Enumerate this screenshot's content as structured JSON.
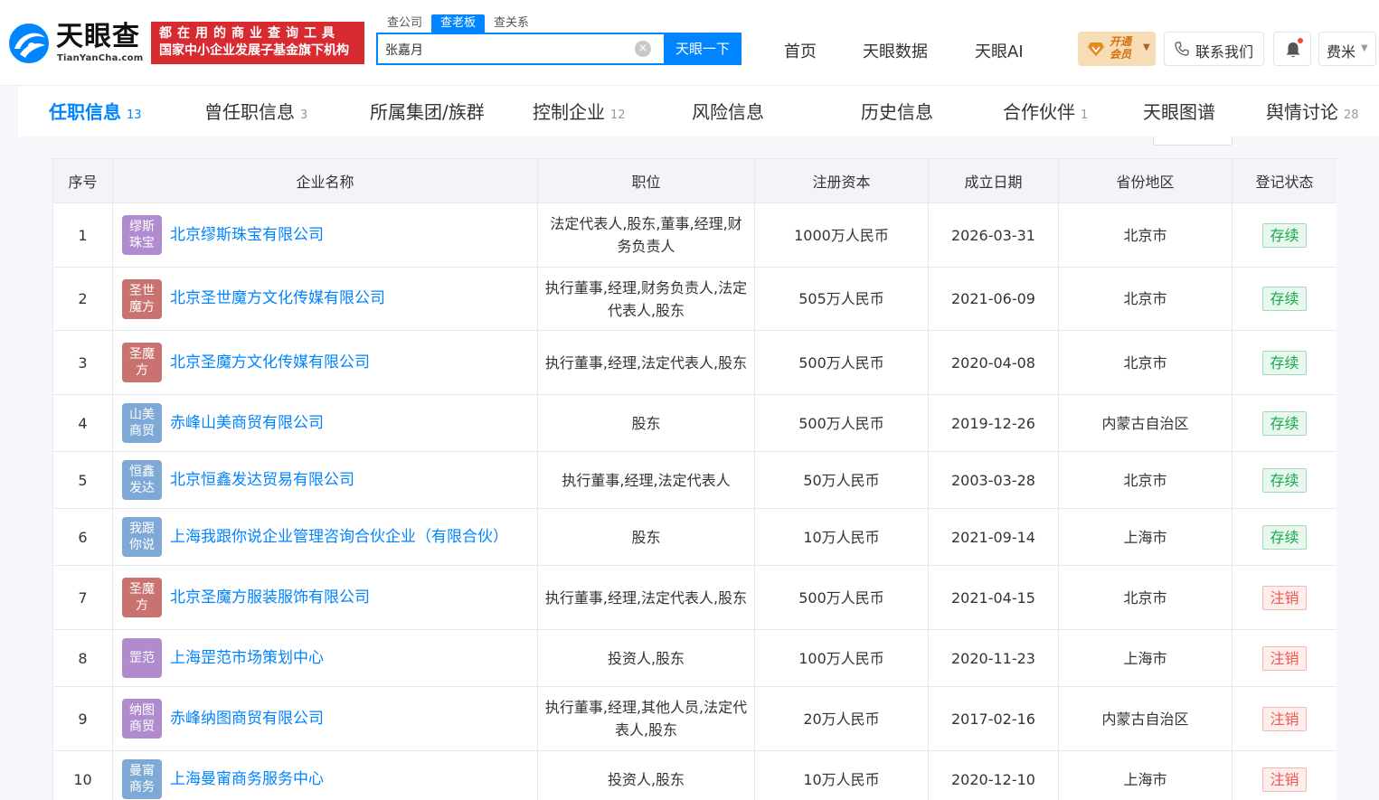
{
  "brand": {
    "title": "天眼查",
    "subtitle": "TianYanCha.com",
    "slogan_line1": "都在用的商业查询工具",
    "slogan_line2": "国家中小企业发展子基金旗下机构",
    "color_brand": "#0084ff",
    "color_slogan": "#d72a31"
  },
  "search": {
    "tabs": [
      "查公司",
      "查老板",
      "查关系"
    ],
    "active_tab": "查老板",
    "value": "张嘉月",
    "button": "天眼一下"
  },
  "nav": {
    "items": [
      "首页",
      "天眼数据",
      "天眼AI"
    ],
    "vip_line1": "开通",
    "vip_line2": "会员",
    "contact": "联系我们",
    "user": "费米"
  },
  "tabs": [
    {
      "label": "任职信息",
      "count": "13",
      "active": true
    },
    {
      "label": "曾任职信息",
      "count": "3"
    },
    {
      "label": "所属集团/族群",
      "count": ""
    },
    {
      "label": "控制企业",
      "count": "12"
    },
    {
      "label": "风险信息",
      "count": ""
    },
    {
      "label": "历史信息",
      "count": ""
    },
    {
      "label": "合作伙伴",
      "count": "1"
    },
    {
      "label": "天眼图谱",
      "count": ""
    },
    {
      "label": "舆情讨论",
      "count": "28"
    }
  ],
  "table": {
    "headers": [
      "序号",
      "企业名称",
      "职位",
      "注册资本",
      "成立日期",
      "省份地区",
      "登记状态"
    ],
    "rows": [
      {
        "no": "1",
        "logo": "缪斯\n珠宝",
        "logo_color": "#b08ccf",
        "name": "北京缪斯珠宝有限公司",
        "role": "法定代表人,股东,董事,经理,财务负责人",
        "capital": "1000万人民币",
        "date": "2026-03-31",
        "region": "北京市",
        "status": "存续",
        "status_type": "green"
      },
      {
        "no": "2",
        "logo": "圣世\n魔方",
        "logo_color": "#c9726f",
        "name": "北京圣世魔方文化传媒有限公司",
        "role": "执行董事,经理,财务负责人,法定代表人,股东",
        "capital": "505万人民币",
        "date": "2021-06-09",
        "region": "北京市",
        "status": "存续",
        "status_type": "green"
      },
      {
        "no": "3",
        "logo": "圣魔方",
        "logo_color": "#c9726f",
        "name": "北京圣魔方文化传媒有限公司",
        "role": "执行董事,经理,法定代表人,股东",
        "capital": "500万人民币",
        "date": "2020-04-08",
        "region": "北京市",
        "status": "存续",
        "status_type": "green"
      },
      {
        "no": "4",
        "logo": "山美\n商贸",
        "logo_color": "#7ea8d6",
        "name": "赤峰山美商贸有限公司",
        "role": "股东",
        "capital": "500万人民币",
        "date": "2019-12-26",
        "region": "内蒙古自治区",
        "status": "存续",
        "status_type": "green"
      },
      {
        "no": "5",
        "logo": "恒鑫\n发达",
        "logo_color": "#7ea8d6",
        "name": "北京恒鑫发达贸易有限公司",
        "role": "执行董事,经理,法定代表人",
        "capital": "50万人民币",
        "date": "2003-03-28",
        "region": "北京市",
        "status": "存续",
        "status_type": "green"
      },
      {
        "no": "6",
        "logo": "我跟\n你说",
        "logo_color": "#7ea8d6",
        "name": "上海我跟你说企业管理咨询合伙企业（有限合伙）",
        "role": "股东",
        "capital": "10万人民币",
        "date": "2021-09-14",
        "region": "上海市",
        "status": "存续",
        "status_type": "green"
      },
      {
        "no": "7",
        "logo": "圣魔方",
        "logo_color": "#c9726f",
        "name": "北京圣魔方服装服饰有限公司",
        "role": "执行董事,经理,法定代表人,股东",
        "capital": "500万人民币",
        "date": "2021-04-15",
        "region": "北京市",
        "status": "注销",
        "status_type": "red"
      },
      {
        "no": "8",
        "logo": "罡范",
        "logo_color": "#b08ccf",
        "name": "上海罡范市场策划中心",
        "role": "投资人,股东",
        "capital": "100万人民币",
        "date": "2020-11-23",
        "region": "上海市",
        "status": "注销",
        "status_type": "red"
      },
      {
        "no": "9",
        "logo": "纳图\n商贸",
        "logo_color": "#b08ccf",
        "name": "赤峰纳图商贸有限公司",
        "role": "执行董事,经理,其他人员,法定代表人,股东",
        "capital": "20万人民币",
        "date": "2017-02-16",
        "region": "内蒙古自治区",
        "status": "注销",
        "status_type": "red"
      },
      {
        "no": "10",
        "logo": "曼甯\n商务",
        "logo_color": "#7ea8d6",
        "name": "上海曼甯商务服务中心",
        "role": "投资人,股东",
        "capital": "10万人民币",
        "date": "2020-12-10",
        "region": "上海市",
        "status": "注销",
        "status_type": "red"
      }
    ]
  }
}
